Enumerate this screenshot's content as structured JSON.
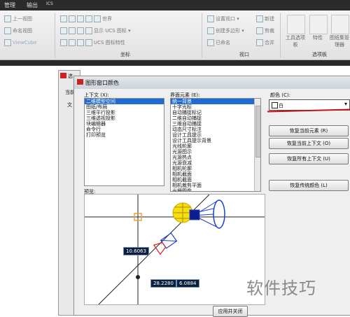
{
  "ribbon": {
    "tabs": [
      "管理",
      "输出",
      "ICS"
    ],
    "row_items": [
      "上一视图",
      "命名视图",
      "ViewCube",
      "世界",
      "显示 UCS 图标",
      "UCS 图标特性",
      "设置视口",
      "创建多边形",
      "已命名",
      "新建",
      "剪裁",
      "合并"
    ],
    "big_buttons": [
      "工具选项板",
      "特性",
      "图纸集管理器"
    ],
    "panels": [
      "坐标",
      "视口",
      "选项板"
    ]
  },
  "dialog": {
    "title": "图形窗口颜色",
    "context_label": "上下文 (X):",
    "context_items": [
      "二维模型空间",
      "图纸/布局",
      "三维平行投影",
      "三维透视投影",
      "块编辑器",
      "命令行",
      "打印预览"
    ],
    "context_selected_index": 0,
    "interface_label": "界面元素 (E):",
    "interface_items": [
      "统一背景",
      "十字光标",
      "自动捕捉标记",
      "二维自动捕捉",
      "三维自动捕捉",
      "动态尺寸标注",
      "设计工具提示",
      "设计工具提示背景",
      "光线轮廓",
      "光源图示",
      "光源热点",
      "光源衰减",
      "相机轮廓",
      "相机截面",
      "相机截面",
      "相机裁剪平面",
      "光栅图像"
    ],
    "interface_selected_index": 0,
    "color_label": "颜色 (C):",
    "color_value": "白",
    "buttons": [
      "恢复当前元素 (R)",
      "恢复当前上下文 (O)",
      "恢复所有上下文 (U)",
      "恢复传统颜色 (L)"
    ],
    "preview_label": "预览:",
    "apply_button": "应用并关闭"
  },
  "background_dialog": {
    "title": "选",
    "label": "当前",
    "header": "文"
  },
  "preview": {
    "tags": [
      "10.6063",
      "28.2280",
      "6.0884"
    ]
  },
  "watermark": "软件技巧",
  "colors": {
    "selection": "#1e6bd6",
    "annotation_line": "#c0141a",
    "dim_tag_bg": "#0b1e3e"
  }
}
